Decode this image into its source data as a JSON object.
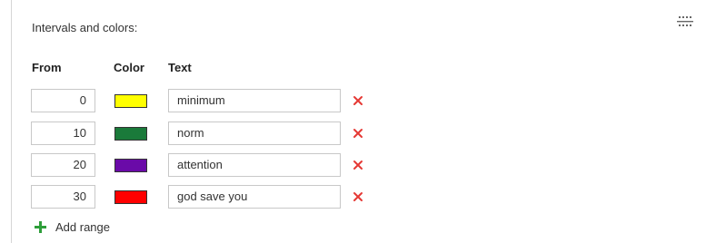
{
  "section": {
    "title": "Intervals and colors:"
  },
  "table": {
    "headers": {
      "from": "From",
      "color": "Color",
      "text": "Text"
    },
    "rows": [
      {
        "from": "0",
        "color": "#ffff00",
        "text": "minimum"
      },
      {
        "from": "10",
        "color": "#1a7a3a",
        "text": "norm"
      },
      {
        "from": "20",
        "color": "#6a0aa8",
        "text": "attention"
      },
      {
        "from": "30",
        "color": "#ff0000",
        "text": "god save you"
      }
    ]
  },
  "actions": {
    "add_range_label": "Add range",
    "add_icon": "plus-icon",
    "remove_icon": "close-icon",
    "menu_icon": "grid-menu-icon"
  },
  "colors": {
    "remove": "#e53935",
    "add": "#2e9e3a"
  }
}
